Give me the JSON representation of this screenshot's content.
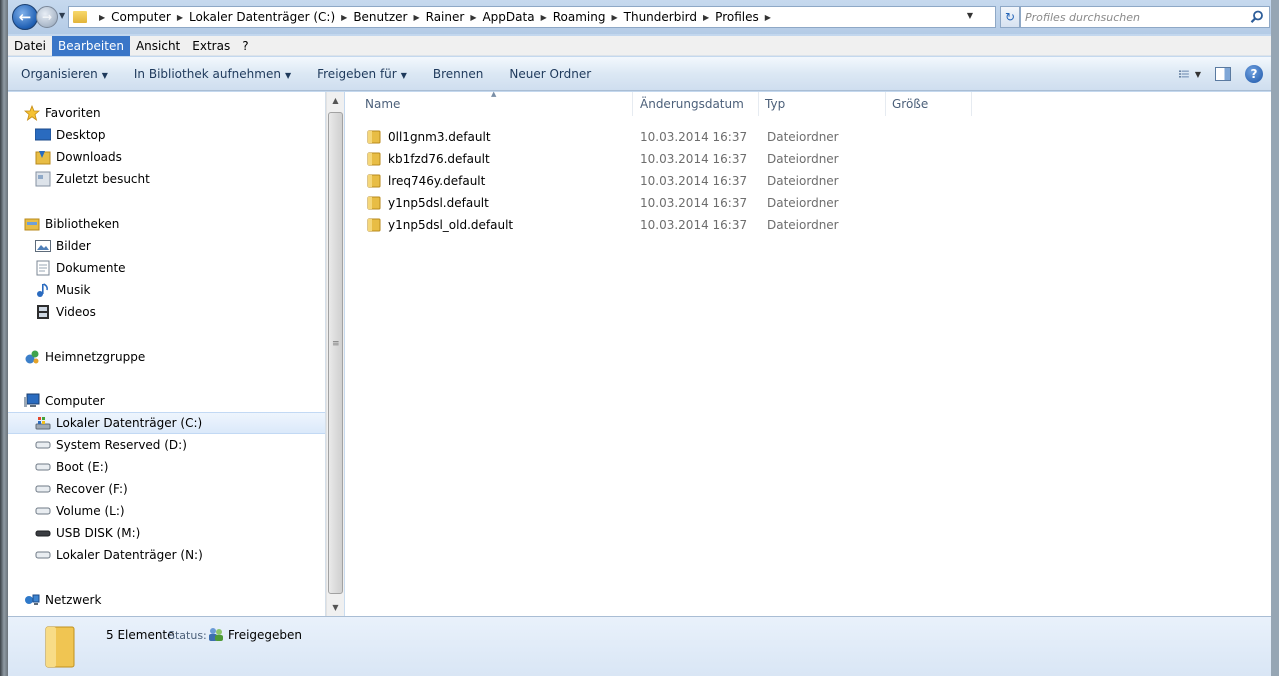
{
  "address_bar": {
    "crumbs": [
      "Computer",
      "Lokaler Datenträger (C:)",
      "Benutzer",
      "Rainer",
      "AppData",
      "Roaming",
      "Thunderbird",
      "Profiles"
    ],
    "search_placeholder": "Profiles durchsuchen"
  },
  "menu": {
    "datei": "Datei",
    "bearbeiten": "Bearbeiten",
    "ansicht": "Ansicht",
    "extras": "Extras",
    "help": "?"
  },
  "toolbar": {
    "organize": "Organisieren",
    "library": "In Bibliothek aufnehmen",
    "share": "Freigeben für",
    "burn": "Brennen",
    "new_folder": "Neuer Ordner"
  },
  "nav": {
    "favorites": "Favoriten",
    "desktop": "Desktop",
    "downloads": "Downloads",
    "recent": "Zuletzt besucht",
    "libraries": "Bibliotheken",
    "pictures": "Bilder",
    "documents": "Dokumente",
    "music": "Musik",
    "videos": "Videos",
    "homegroup": "Heimnetzgruppe",
    "computer": "Computer",
    "drive_c": "Lokaler Datenträger (C:)",
    "drive_d": "System Reserved (D:)",
    "drive_e": "Boot (E:)",
    "drive_f": "Recover (F:)",
    "drive_l": "Volume (L:)",
    "drive_m": "USB DISK (M:)",
    "drive_n": "Lokaler Datenträger (N:)",
    "network": "Netzwerk"
  },
  "columns": {
    "name": "Name",
    "date": "Änderungsdatum",
    "type": "Typ",
    "size": "Größe"
  },
  "files": [
    {
      "name": "0ll1gnm3.default",
      "date": "10.03.2014 16:37",
      "type": "Dateiordner"
    },
    {
      "name": "kb1fzd76.default",
      "date": "10.03.2014 16:37",
      "type": "Dateiordner"
    },
    {
      "name": "lreq746y.default",
      "date": "10.03.2014 16:37",
      "type": "Dateiordner"
    },
    {
      "name": "y1np5dsl.default",
      "date": "10.03.2014 16:37",
      "type": "Dateiordner"
    },
    {
      "name": "y1np5dsl_old.default",
      "date": "10.03.2014 16:37",
      "type": "Dateiordner"
    }
  ],
  "details": {
    "count": "5 Elemente",
    "status_label": "Status:",
    "status_value": "Freigegeben"
  },
  "colors": {
    "selected_menu": "#3a76c8",
    "folder": "#e8bd45"
  }
}
